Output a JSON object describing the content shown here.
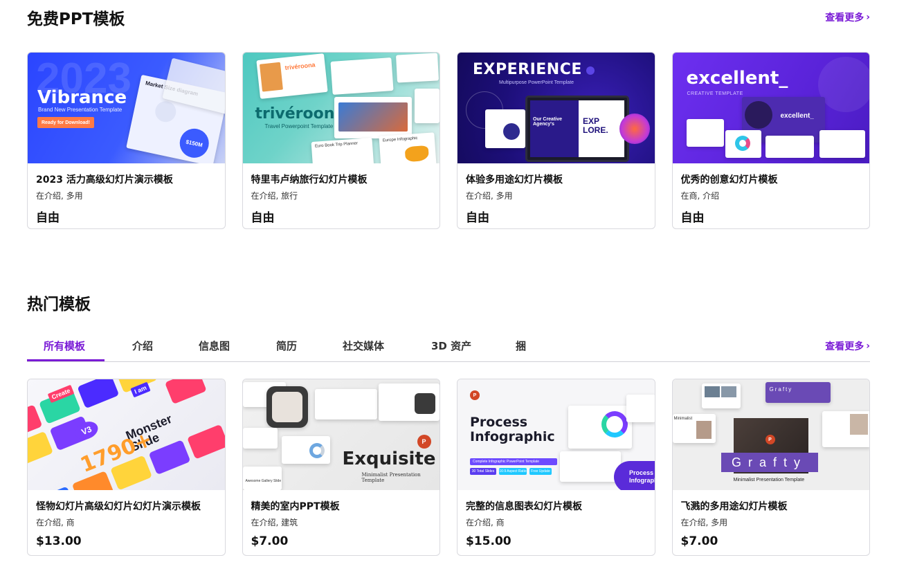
{
  "free_section": {
    "title": "免费PPT模板",
    "more_label": "查看更多",
    "cards": [
      {
        "title": "2023 活力高级幻灯片演示模板",
        "tags": "在介绍, 多用",
        "price": "自由",
        "thumb": {
          "title": "Vibrance",
          "subtitle": "Brand New Presentation Template",
          "button": "Ready for Download!",
          "badge": "2023",
          "card": "Market Size diagram",
          "stat": "$150M"
        }
      },
      {
        "title": "特里韦卢纳旅行幻灯片模板",
        "tags": "在介绍, 旅行",
        "price": "自由",
        "thumb": {
          "title": "trivéroona",
          "subtitle": "Travel Powerpoint Template",
          "card": "Euro Book Trip Planner",
          "card2": "Europe Infographic"
        }
      },
      {
        "title": "体验多用途幻灯片模板",
        "tags": "在介绍, 多用",
        "price": "自由",
        "thumb": {
          "title": "EXPERIENCE",
          "subtitle": "Multipurpose PowerPoint Template",
          "card": "Our Creative Agency's",
          "card2": "EXP LORE."
        }
      },
      {
        "title": "优秀的创意幻灯片模板",
        "tags": "在商, 介绍",
        "price": "自由",
        "thumb": {
          "title": "excellent_",
          "subtitle": "CREATIVE TEMPLATE",
          "card": "excellent_"
        }
      }
    ]
  },
  "hot_section": {
    "title": "热门模板",
    "more_label": "查看更多",
    "tabs": [
      "所有模板",
      "介绍",
      "信息图",
      "简历",
      "社交媒体",
      "3D 资产",
      "捆"
    ],
    "active_tab": 0,
    "cards": [
      {
        "title": "怪物幻灯片高级幻灯片幻灯片演示模板",
        "tags": "在介绍, 商",
        "price": "$13.00",
        "thumb": {
          "title": "Monster Slide",
          "num": "1790+",
          "version": "V3",
          "chip1": "Create",
          "chip2": "I am"
        }
      },
      {
        "title": "精美的室内PPT模板",
        "tags": "在介绍, 建筑",
        "price": "$7.00",
        "thumb": {
          "title": "Exquisite",
          "subtitle": "Minimalist Presentation Template",
          "card": "Awesome Gallery Slide"
        }
      },
      {
        "title": "完整的信息图表幻灯片模板",
        "tags": "在介绍, 商",
        "price": "$15.00",
        "thumb": {
          "title": "Process Infographic",
          "subtitle": "Complete Infographic PowerPoint Template",
          "chips": [
            "30 Total Slides",
            "16:9 Aspect Ratio",
            "Free Update"
          ],
          "badge": "Process Infographi"
        }
      },
      {
        "title": "飞溅的多用途幻灯片模板",
        "tags": "在介绍, 多用",
        "price": "$7.00",
        "thumb": {
          "title": "Grafty",
          "subtitle": "Minimalist Presentation Template",
          "tag": "Grafty",
          "card": "Minimalist"
        }
      }
    ]
  },
  "colors": {
    "accent": "#7a1bd6",
    "border": "#d9d9de"
  },
  "icons": {
    "chevron": "chevron-right-icon"
  }
}
